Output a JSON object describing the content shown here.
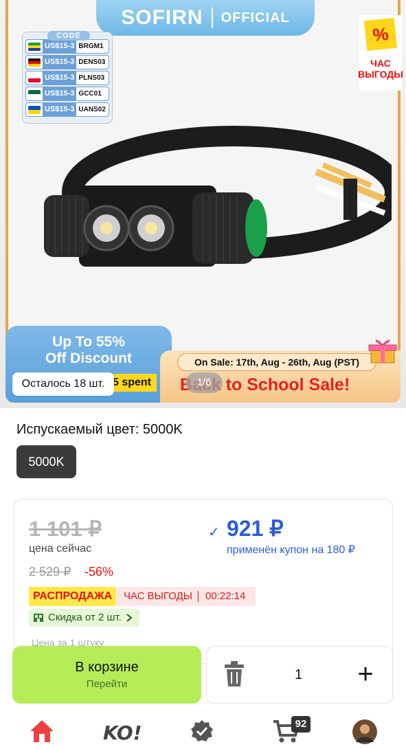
{
  "banner": {
    "brand": "SOFIRN",
    "brand_sub": "OFFICIAL",
    "promo_flag": {
      "symbol": "%",
      "text": "ЧАС ВЫГОДЫ"
    },
    "codes_header": "CODE",
    "codes": [
      {
        "amount": "US$15-3",
        "code": "BRGM1",
        "flag_colors": [
          "#1a9c3a",
          "#ffd71a",
          "#1c3ea0"
        ]
      },
      {
        "amount": "US$15-3",
        "code": "DENS03",
        "flag_colors": [
          "#111111",
          "#dd1111",
          "#ffcc00"
        ]
      },
      {
        "amount": "US$15-3",
        "code": "PLNS03",
        "flag_colors": [
          "#ffffff",
          "#dc1430"
        ]
      },
      {
        "amount": "US$15-3",
        "code": "GCC01",
        "flag_colors": [
          "#0b6b3a",
          "#ffffff"
        ]
      },
      {
        "amount": "US$15-3",
        "code": "UANS02",
        "flag_colors": [
          "#0057b8",
          "#ffd700"
        ]
      }
    ],
    "discount_line1": "Up To 55%",
    "discount_line2": "Off Discount",
    "spent_text": "5 spent",
    "on_sale": "On Sale: 17th, Aug - 26th, Aug (PST)",
    "school_sale": "Back to School Sale!",
    "stock_left": "Осталось 18 шт.",
    "pager": "1/6"
  },
  "product": {
    "color_label": "Испускаемый цвет: 5000K",
    "color_chip": "5000K"
  },
  "price": {
    "old_price": "1 101 ₽",
    "now_label": "цена сейчас",
    "check": "✓",
    "new_price": "921 ₽",
    "coupon_note": "применён купон на 180 ₽",
    "original_price": "2 529 ₽",
    "discount_pct": "-56%",
    "tag_sale": "РАСПРОДАЖА",
    "tag_hour": "ЧАС ВЫГОДЫ",
    "timer": "00:22:14",
    "bulk_discount": "Скидка от 2 шт.",
    "per_unit": "Цена за 1 штуку"
  },
  "actions": {
    "cart_label": "В корзине",
    "cart_sub": "Перейти",
    "quantity": "1",
    "plus": "+"
  },
  "tabbar": {
    "cart_badge": "92",
    "ko_label": "KO!",
    "accent": "#f0413e"
  }
}
